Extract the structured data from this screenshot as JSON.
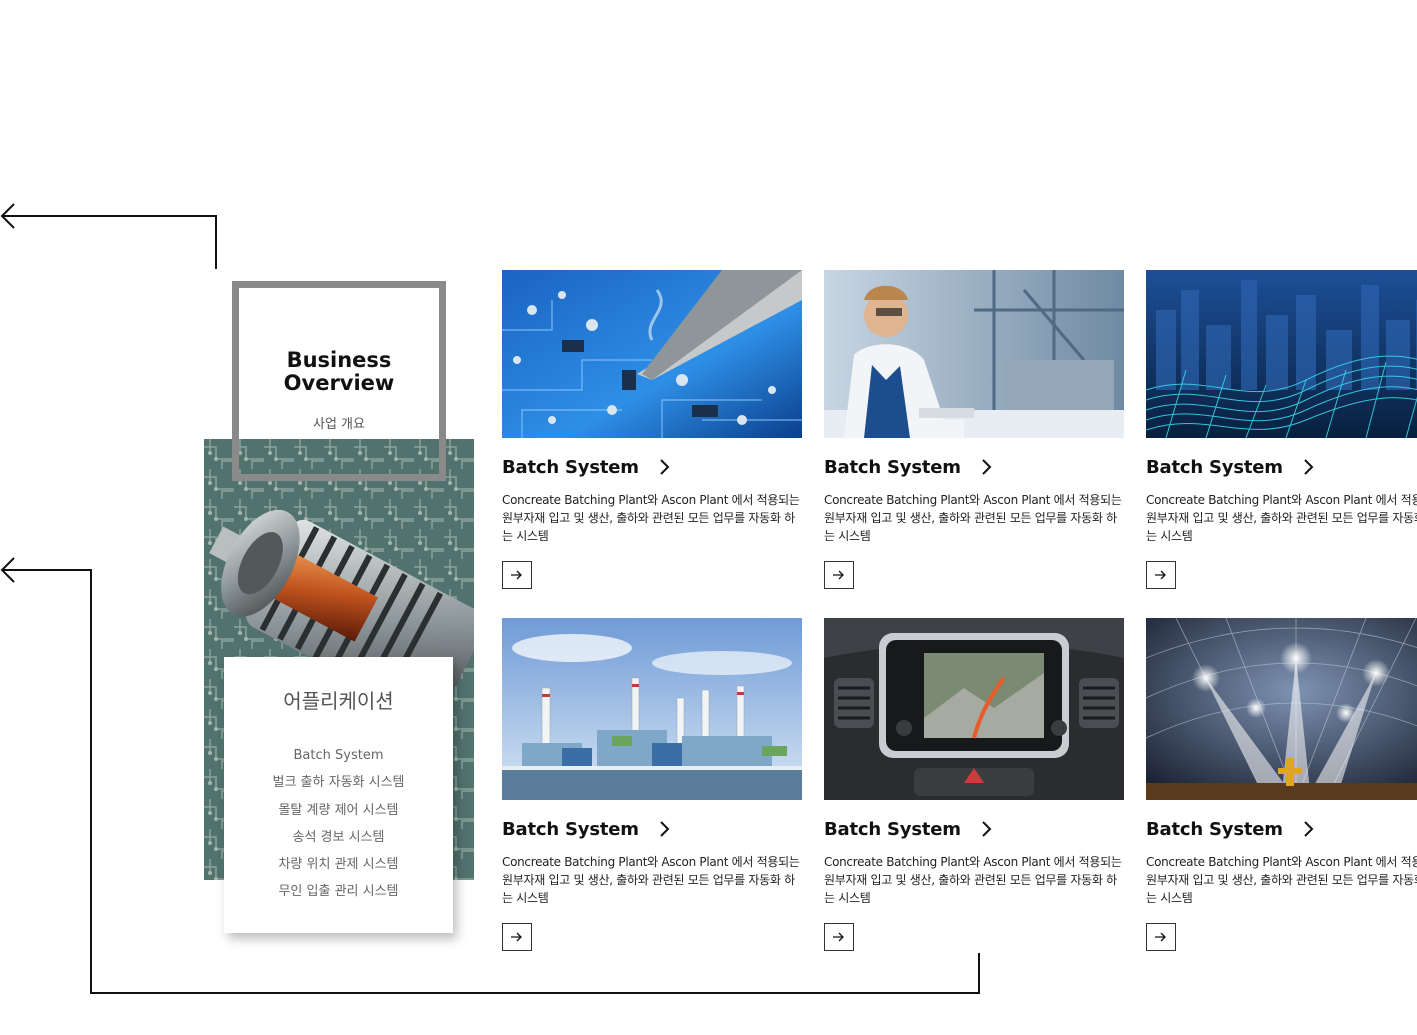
{
  "overview": {
    "title_line1": "Business",
    "title_line2": "Overview",
    "subtitle": "사업 개요"
  },
  "applications": {
    "title": "어플리케이션",
    "items": [
      "Batch System",
      "벌크 출하 자동화 시스템",
      "몰탈 계량 제어 시스템",
      "송석 경보 시스템",
      "차량 위치 관제 시스템",
      "무인 입출 관리 시스템"
    ]
  },
  "cards": [
    {
      "title": "Batch System",
      "desc": "Concreate Batching Plant와 Ascon Plant 에서 적용되는 원부자재 입고 및 생산, 출하와 관련된 모든 업무를 자동화 하는 시스템",
      "image": "circuit-board-soldering"
    },
    {
      "title": "Batch System",
      "desc": "Concreate Batching Plant와 Ascon Plant 에서 적용되는 원부자재 입고 및 생산, 출하와 관련된 모든 업무를 자동화 하는 시스템",
      "image": "engineer-in-lab"
    },
    {
      "title": "Batch System",
      "desc": "Concreate Batching Plant와 Ascon Plant 에서 적용되는 원부자재 입고 및 생산, 출하와 관련된 모든 업무를 자동화 하는 시스템",
      "image": "digital-city-wave"
    },
    {
      "title": "Batch System",
      "desc": "Concreate Batching Plant와 Ascon Plant 에서 적용되는 원부자재 입고 및 생산, 출하와 관련된 모든 업무를 자동화 하는 시스템",
      "image": "power-plant"
    },
    {
      "title": "Batch System",
      "desc": "Concreate Batching Plant와 Ascon Plant 에서 적용되는 원부자재 입고 및 생산, 출하와 관련된 모든 업무를 자동화 하는 시스템",
      "image": "car-navigation"
    },
    {
      "title": "Batch System",
      "desc": "Concreate Batching Plant와 Ascon Plant 에서 적용되는 원부자재 입고 및 생산, 출하와 관련된 모든 업무를 자동화 하는 시스템",
      "image": "dome-lights"
    }
  ],
  "icons": {
    "connector_arrow": "left-arrow-icon",
    "title_chevron": "chevron-right-icon",
    "go_button": "right-arrow-icon"
  }
}
